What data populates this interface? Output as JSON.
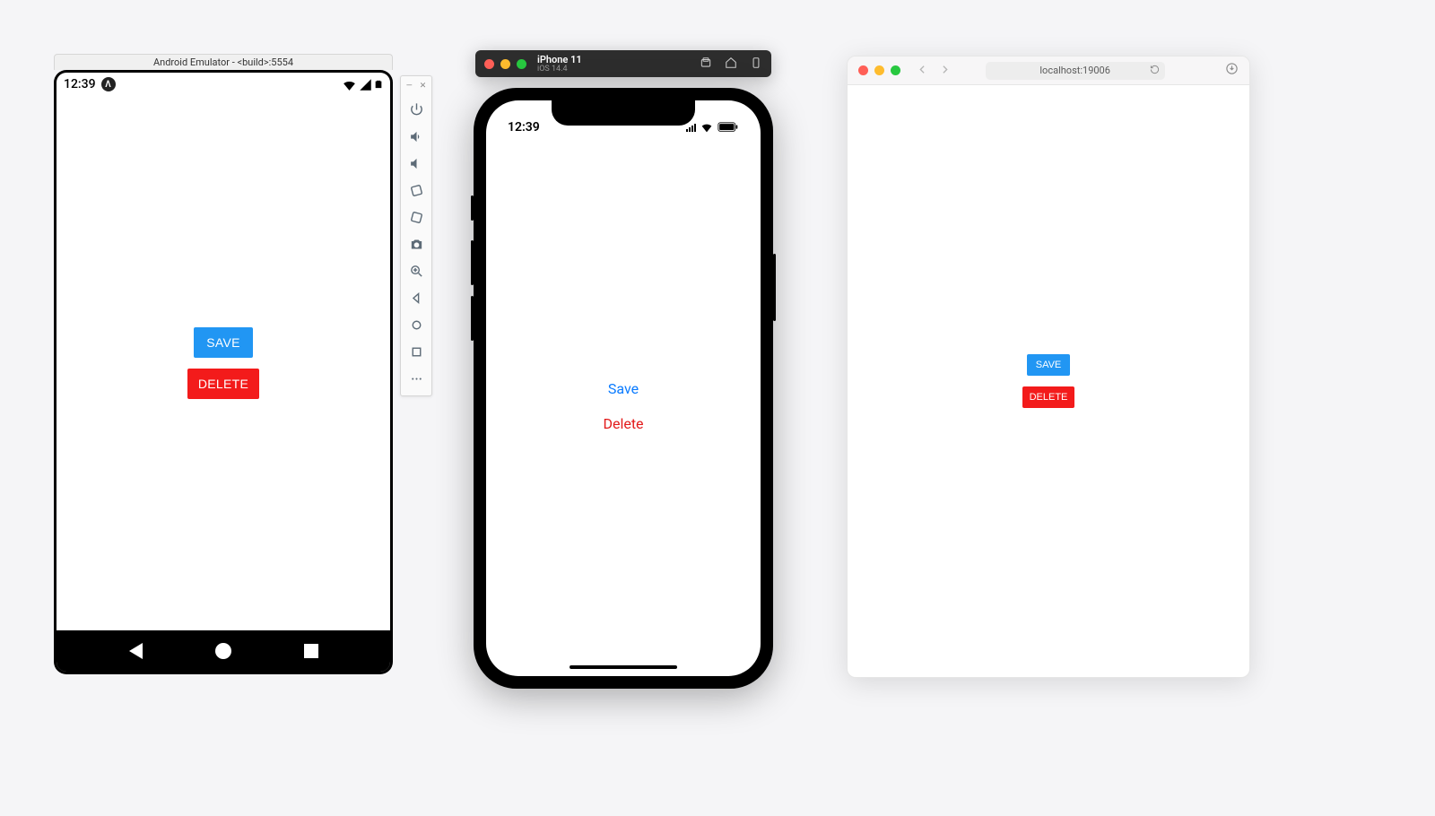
{
  "android": {
    "titlebar": "Android Emulator - <build>:5554",
    "time": "12:39",
    "buttons": {
      "save": "SAVE",
      "delete": "DELETE"
    },
    "toolbar_icons": [
      "minimize",
      "close",
      "power",
      "volume-up",
      "volume-down",
      "rotate-left",
      "rotate-right",
      "camera",
      "zoom",
      "back",
      "home",
      "overview",
      "more"
    ]
  },
  "ios": {
    "device_name": "iPhone 11",
    "os_version": "iOS 14.4",
    "time": "12:39",
    "buttons": {
      "save": "Save",
      "delete": "Delete"
    },
    "titlebar_icons": [
      "screenshot",
      "home",
      "external"
    ]
  },
  "safari": {
    "url": "localhost:19006",
    "buttons": {
      "save": "SAVE",
      "delete": "DELETE"
    }
  },
  "colors": {
    "save_bg": "#2196f3",
    "delete_bg": "#f31b1b",
    "ios_link_blue": "#0a7bff",
    "ios_link_red": "#e21a1a"
  }
}
